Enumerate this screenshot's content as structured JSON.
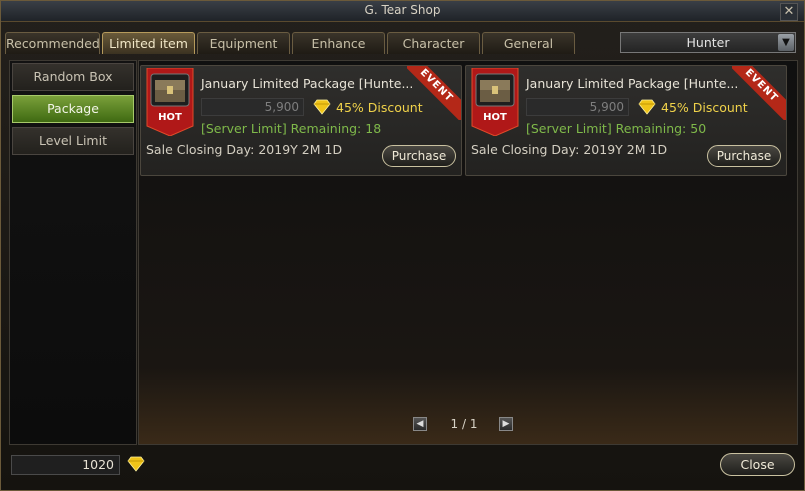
{
  "window": {
    "title": "G. Tear Shop"
  },
  "tabs": [
    {
      "label": "Recommended",
      "active": false
    },
    {
      "label": "Limited item",
      "active": true
    },
    {
      "label": "Equipment",
      "active": false
    },
    {
      "label": "Enhance",
      "active": false
    },
    {
      "label": "Character",
      "active": false
    },
    {
      "label": "General",
      "active": false
    }
  ],
  "class_select": {
    "value": "Hunter"
  },
  "sidebar": {
    "items": [
      {
        "label": "Random Box",
        "active": false
      },
      {
        "label": "Package",
        "active": true
      },
      {
        "label": "Level Limit",
        "active": false
      }
    ]
  },
  "products": [
    {
      "name": "January Limited Package [Hunte...",
      "price": "5,900",
      "discount": "45% Discount",
      "limit": "[Server Limit] Remaining: 18",
      "closing": "Sale Closing Day: 2019Y 2M 1D",
      "purchase_label": "Purchase",
      "badge": "HOT",
      "ribbon": "EVENT"
    },
    {
      "name": "January Limited Package [Hunte...",
      "price": "5,900",
      "discount": "45% Discount",
      "limit": "[Server Limit] Remaining: 50",
      "closing": "Sale Closing Day: 2019Y 2M 1D",
      "purchase_label": "Purchase",
      "badge": "HOT",
      "ribbon": "EVENT"
    }
  ],
  "pager": {
    "text": "1 / 1"
  },
  "footer": {
    "balance": "1020",
    "close_label": "Close"
  },
  "colors": {
    "accent_green": "#5f8a24",
    "gem": "#f0c419",
    "discount": "#f0d24a",
    "limit_text": "#7fb94a",
    "ribbon": "#b42818"
  }
}
